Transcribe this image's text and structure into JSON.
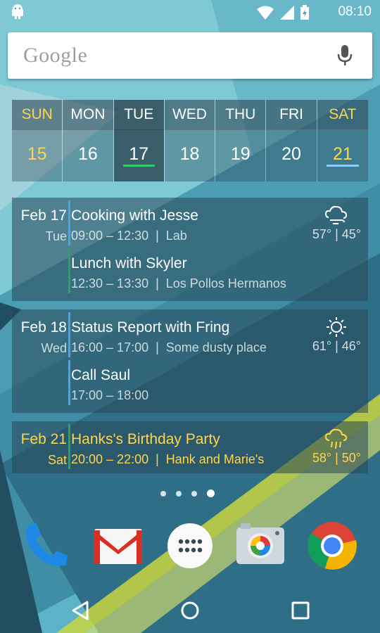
{
  "status_bar": {
    "time": "08:10"
  },
  "search": {
    "logo_text": "Google"
  },
  "week": {
    "days": [
      {
        "name": "SUN",
        "num": "15",
        "weekend": true
      },
      {
        "name": "MON",
        "num": "16",
        "weekend": false
      },
      {
        "name": "TUE",
        "num": "17",
        "weekend": false,
        "today": true
      },
      {
        "name": "WED",
        "num": "18",
        "weekend": false
      },
      {
        "name": "THU",
        "num": "19",
        "weekend": false
      },
      {
        "name": "FRI",
        "num": "20",
        "weekend": false
      },
      {
        "name": "SAT",
        "num": "21",
        "weekend": true
      }
    ]
  },
  "agenda": [
    {
      "date": "Feb 17",
      "weekday": "Tue",
      "weather": {
        "icon": "cloud-wind-icon",
        "temps": "57° | 45°"
      },
      "events": [
        {
          "title": "Cooking with Jesse",
          "time": "09:00 – 12:30  |  Lab",
          "color": "#42a5f5"
        },
        {
          "title": "Lunch with Skyler",
          "time": "12:30 – 13:30  |  Los Pollos Hermanos",
          "color": "#26a65b"
        }
      ]
    },
    {
      "date": "Feb 18",
      "weekday": "Wed",
      "weather": {
        "icon": "sun-icon",
        "temps": "61° | 46°"
      },
      "events": [
        {
          "title": "Status Report with Fring",
          "time": "16:00 – 17:00  |  Some dusty place",
          "color": "#42a5f5"
        },
        {
          "title": "Call Saul",
          "time": "17:00 – 18:00",
          "color": "#42a5f5"
        }
      ]
    },
    {
      "date": "Feb 21",
      "weekday": "Sat",
      "weather": {
        "icon": "rain-cloud-icon",
        "temps": "58° | 50°"
      },
      "events": [
        {
          "title": "Hanks's Birthday Party",
          "time": "20:00 – 22:00  |  Hank and Marie's",
          "color": "#26a65b"
        }
      ]
    }
  ],
  "colors": {
    "weekend": "#ffd54f",
    "today_underline": "#2ecc71",
    "sat_underline": "#90caf9"
  },
  "dock": [
    "phone-icon",
    "gmail-icon",
    "app-drawer-icon",
    "camera-icon",
    "chrome-icon"
  ],
  "page_indicator": {
    "count": 4,
    "active": 3
  }
}
